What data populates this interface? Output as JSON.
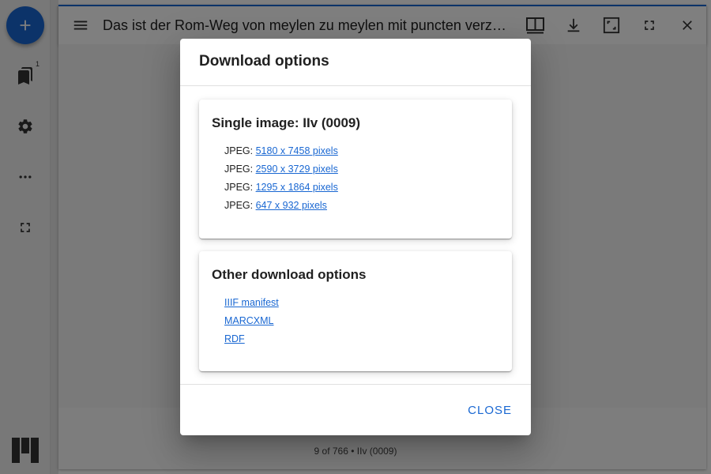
{
  "app": {
    "left_rail": {
      "add_button_icon": "plus-icon",
      "items": [
        {
          "name": "index-icon",
          "badge": "1"
        },
        {
          "name": "settings-icon"
        },
        {
          "name": "more-icon"
        },
        {
          "name": "fullscreen-icon"
        }
      ],
      "logo": "mirador-logo"
    },
    "window": {
      "title": "Das ist der Rom-Weg von meylen zu meylen mit puncten verzeychnet von einer stat zu der andern durch deutzsche lantt",
      "toolbar": [
        "book-view-icon",
        "download-icon",
        "maximize-icon",
        "fullscreen-icon",
        "close-icon"
      ],
      "canvas_info": "9 of 766 • IIv (0009)"
    },
    "accent_color": "#1967d2"
  },
  "dialog": {
    "title": "Download options",
    "single_image": {
      "heading": "Single image: IIv (0009)",
      "items": [
        {
          "label": "JPEG: ",
          "link": "5180 x 7458 pixels"
        },
        {
          "label": "JPEG: ",
          "link": "2590 x 3729 pixels"
        },
        {
          "label": "JPEG: ",
          "link": "1295 x 1864 pixels"
        },
        {
          "label": "JPEG: ",
          "link": "647 x 932 pixels"
        }
      ]
    },
    "other": {
      "heading": "Other download options",
      "links": [
        "IIIF manifest",
        "MARCXML",
        "RDF"
      ]
    },
    "close_label": "CLOSE"
  }
}
